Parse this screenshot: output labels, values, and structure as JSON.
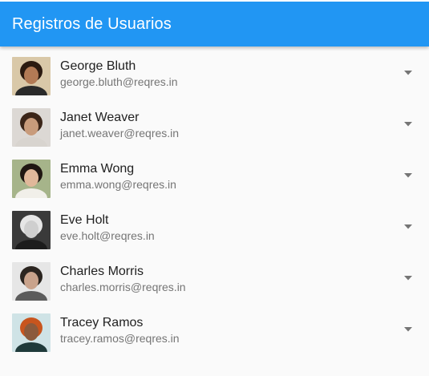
{
  "app": {
    "title": "Registros de Usuarios"
  },
  "users": [
    {
      "name": "George Bluth",
      "email": "george.bluth@reqres.in",
      "avatar_bg": "#d9c8a8",
      "skin": "#b27a55",
      "hair": "#2b1a10",
      "shirt": "#2a2a2a"
    },
    {
      "name": "Janet Weaver",
      "email": "janet.weaver@reqres.in",
      "avatar_bg": "#dcd8d4",
      "skin": "#c89b7b",
      "hair": "#3b2518",
      "shirt": "#d8d4cf"
    },
    {
      "name": "Emma Wong",
      "email": "emma.wong@reqres.in",
      "avatar_bg": "#a6b48a",
      "skin": "#e0b89a",
      "hair": "#1f1712",
      "shirt": "#f1efe9"
    },
    {
      "name": "Eve Holt",
      "email": "eve.holt@reqres.in",
      "avatar_bg": "#3a3a3a",
      "skin": "#cfcfcf",
      "hair": "#e6e6e6",
      "shirt": "#1c1c1c"
    },
    {
      "name": "Charles Morris",
      "email": "charles.morris@reqres.in",
      "avatar_bg": "#e6e6e6",
      "skin": "#c9a38c",
      "hair": "#2b2520",
      "shirt": "#5b5b5b"
    },
    {
      "name": "Tracey Ramos",
      "email": "tracey.ramos@reqres.in",
      "avatar_bg": "#cfe3e6",
      "skin": "#8b5a3c",
      "hair": "#c8551e",
      "shirt": "#1f3a3a"
    }
  ],
  "colors": {
    "appbar": "#2196f3",
    "chevron": "#757575"
  },
  "icons": {
    "row_action": "arrow-drop-down-icon"
  }
}
